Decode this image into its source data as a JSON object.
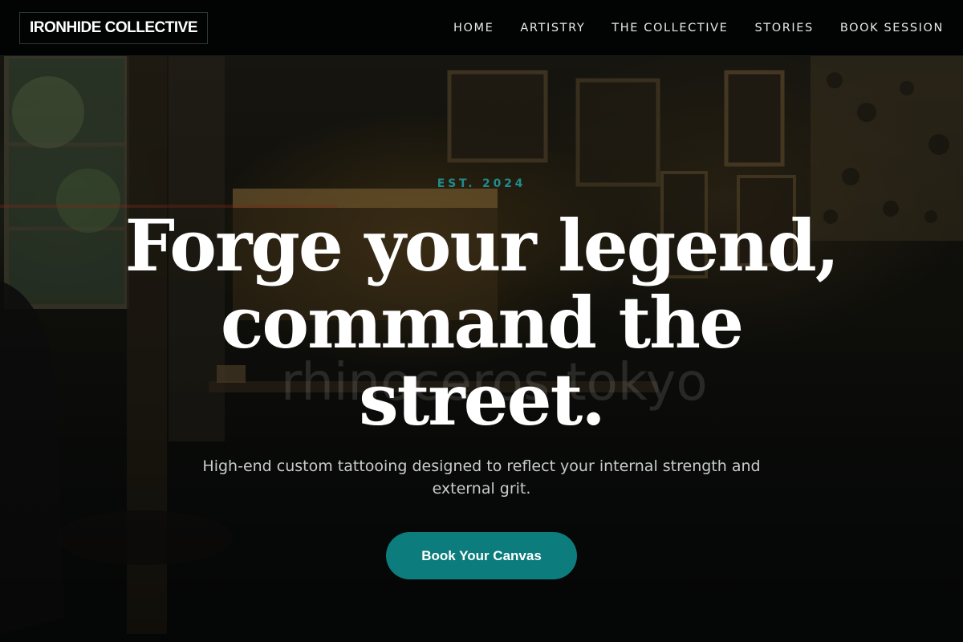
{
  "header": {
    "logo": "IRONHIDE COLLECTIVE",
    "nav": [
      "HOME",
      "ARTISTRY",
      "THE COLLECTIVE",
      "STORIES",
      "BOOK SESSION"
    ]
  },
  "hero": {
    "eyebrow": "EST. 2024",
    "headline": "Forge your legend, command the street.",
    "subtext": "High-end custom tattooing designed to reflect your internal strength and external grit.",
    "cta_label": "Book Your Canvas",
    "watermark": "rhinoceros tokyo"
  },
  "colors": {
    "accent": "#0d7c7c",
    "eyebrow": "#1f8c8c",
    "header_bg": "#020303"
  }
}
